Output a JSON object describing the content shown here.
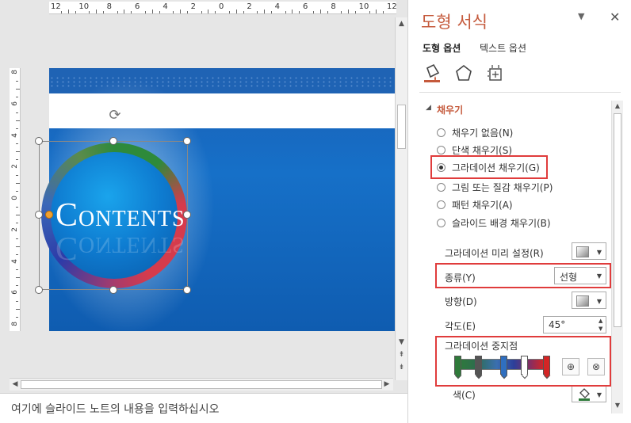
{
  "editor": {
    "ruler_h_labels": [
      "12",
      "10",
      "8",
      "6",
      "4",
      "2",
      "0",
      "2",
      "4",
      "6",
      "8",
      "10",
      "12"
    ],
    "ruler_v_labels": [
      "8",
      "6",
      "4",
      "2",
      "0",
      "2",
      "4",
      "6",
      "8"
    ],
    "slide": {
      "title_first": "C",
      "title_rest": "ONTENTS"
    },
    "notes_placeholder": "여기에 슬라이드 노트의 내용을 입력하십시오"
  },
  "pane": {
    "title": "도형 서식",
    "menu_glyph": "▼",
    "close_glyph": "✕",
    "tabs": [
      {
        "label": "도형 옵션",
        "active": true
      },
      {
        "label": "텍스트 옵션",
        "active": false
      }
    ],
    "icons": [
      "fill-line-icon",
      "effects-pentagon-icon",
      "size-properties-icon"
    ],
    "section": {
      "caret": "◢",
      "title": "채우기"
    },
    "fill_options": [
      {
        "label": "채우기 없음(N)",
        "selected": false
      },
      {
        "label": "단색 채우기(S)",
        "selected": false
      },
      {
        "label": "그라데이션 채우기(G)",
        "selected": true
      },
      {
        "label": "그림 또는 질감 채우기(P)",
        "selected": false
      },
      {
        "label": "패턴 채우기(A)",
        "selected": false
      },
      {
        "label": "슬라이드 배경 채우기(B)",
        "selected": false
      }
    ],
    "gradient_preset_label": "그라데이션 미리 설정(R)",
    "type_label": "종류(Y)",
    "type_value": "선형",
    "direction_label": "방향(D)",
    "angle_label": "각도(E)",
    "angle_value": "45°",
    "stops_label": "그라데이션 중지점",
    "stop_colors": [
      "#2f7a3a",
      "#555555",
      "#2f6fc0",
      "#ffffff",
      "#d42525"
    ],
    "color_label": "색(C)",
    "accent_color": "#c55a3c",
    "highlight_color": "#e03c3c"
  }
}
